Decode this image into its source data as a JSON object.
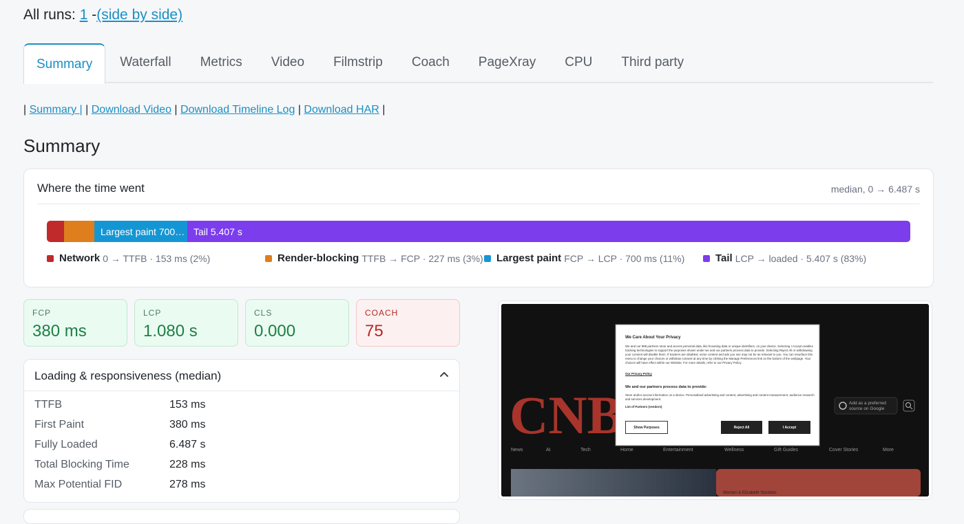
{
  "header": {
    "prefix": "All runs: ",
    "run_link": "1",
    "dash": " -",
    "side_by_side": "(side by side)"
  },
  "tabs": [
    {
      "label": "Summary",
      "active": true
    },
    {
      "label": "Waterfall"
    },
    {
      "label": "Metrics"
    },
    {
      "label": "Video"
    },
    {
      "label": "Filmstrip"
    },
    {
      "label": "Coach"
    },
    {
      "label": "PageXray"
    },
    {
      "label": "CPU"
    },
    {
      "label": "Third party"
    }
  ],
  "links": {
    "sep": "|",
    "summary": "Summary |",
    "download_video": "Download Video",
    "download_timeline": "Download Timeline Log",
    "download_har": "Download HAR"
  },
  "summary_heading": "Summary",
  "time_card": {
    "title": "Where the time went",
    "meta": "median, 0 → 6.487 s",
    "segments": [
      {
        "label": "",
        "color": "#c02a2a",
        "fraction": 0.02
      },
      {
        "label": "",
        "color": "#de7e1d",
        "fraction": 0.035
      },
      {
        "label": "Largest paint 700…",
        "color": "#1596d4",
        "fraction": 0.108
      },
      {
        "label": "Tail 5.407 s",
        "color": "#7c3ded",
        "fraction": 0.837
      }
    ],
    "legend": [
      {
        "name": "Network",
        "desc": "0 → TTFB · 153 ms (2%)",
        "color": "#c02a2a"
      },
      {
        "name": "Render-blocking",
        "desc": "TTFB → FCP · 227 ms (3%)",
        "color": "#de7e1d"
      },
      {
        "name": "Largest paint",
        "desc": "FCP → LCP · 700 ms (11%)",
        "color": "#1596d4"
      },
      {
        "name": "Tail",
        "desc": "LCP → loaded · 5.407 s (83%)",
        "color": "#7c3ded"
      }
    ]
  },
  "metrics": [
    {
      "label": "FCP",
      "value": "380 ms",
      "status": "good"
    },
    {
      "label": "LCP",
      "value": "1.080 s",
      "status": "good"
    },
    {
      "label": "CLS",
      "value": "0.000",
      "status": "good"
    },
    {
      "label": "COACH",
      "value": "75",
      "status": "bad"
    }
  ],
  "loading": {
    "title": "Loading & responsiveness (median)",
    "rows": [
      {
        "k": "TTFB",
        "v": "153 ms"
      },
      {
        "k": "First Paint",
        "v": "380 ms"
      },
      {
        "k": "Fully Loaded",
        "v": "6.487 s"
      },
      {
        "k": "Total Blocking Time",
        "v": "228 ms"
      },
      {
        "k": "Max Potential FID",
        "v": "278 ms"
      }
    ]
  },
  "screenshot": {
    "logo": "CNB",
    "search_hint": "Add as a preferred source on Google",
    "nav": [
      "News",
      "AI",
      "Tech",
      "Home",
      "Entertainment",
      "Wellness",
      "Gift Guides",
      "Cover Stories",
      "More"
    ],
    "story": "Women & Elizabeth Stockton",
    "dialog": {
      "title": "We Care About Your Privacy",
      "body": "We and our 888 partners store and access personal data, like browsing data or unique identifiers, on your device. Selecting I Accept enables tracking technologies to support the purposes shown under we and our partners process data to provide. Selecting Reject All or withdrawing your consent will disable them. If trackers are disabled, some content and ads you see may not be as relevant to you. You can resurface this menu to change your choices or withdraw consent at any time by clicking the Manage Preferences link on the bottom of the webpage. Your choices will have effect within our Website. For more details, refer to our Privacy Policy.",
      "policy_link": "Our Privacy Policy",
      "subhead": "We and our partners process data to provide:",
      "purposes": "Store and/or access information on a device. Personalised advertising and content, advertising and content measurement, audience research and services development.",
      "vendors": "List of Partners (vendors)",
      "btn_purposes": "Show Purposes",
      "btn_reject": "Reject All",
      "btn_accept": "I Accept"
    }
  }
}
